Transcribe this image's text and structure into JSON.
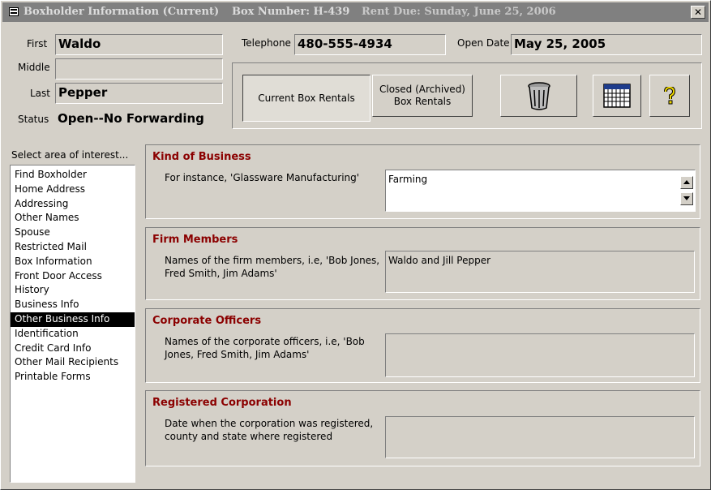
{
  "window": {
    "title": "Boxholder Information (Current)",
    "box_number": "Box Number: H-439",
    "rent_due": "Rent Due: Sunday, June 25, 2006",
    "close_glyph": "✕"
  },
  "fields": {
    "first_label": "First",
    "first_value": "Waldo",
    "middle_label": "Middle",
    "middle_value": "",
    "last_label": "Last",
    "last_value": "Pepper",
    "status_label": "Status",
    "status_value": "Open--No Forwarding",
    "telephone_label": "Telephone",
    "telephone_value": "480-555-4934",
    "open_date_label": "Open Date",
    "open_date_value": "May 25, 2005"
  },
  "toolbar": {
    "current_rentals_label": "Current Box Rentals",
    "closed_rentals_label": "Closed (Archived) Box Rentals",
    "trash_icon": "trash-can-icon",
    "calendar_icon": "calendar-icon",
    "help_icon": "question-mark-icon"
  },
  "nav": {
    "heading": "Select area of interest...",
    "items": [
      "Find Boxholder",
      "Home Address",
      "Addressing",
      "Other Names",
      "Spouse",
      "Restricted Mail",
      "Box Information",
      "Front Door Access",
      "History",
      "Business Info",
      "Other Business Info",
      "Identification",
      "Credit Card Info",
      "Other Mail Recipients",
      "Printable Forms"
    ],
    "selected_index": 10
  },
  "panels": {
    "kind_of_business": {
      "title": "Kind of Business",
      "description": "For instance, 'Glassware Manufacturing'",
      "value": "Farming"
    },
    "firm_members": {
      "title": "Firm Members",
      "description": "Names of the firm members, i.e, 'Bob Jones, Fred Smith, Jim Adams'",
      "value": "Waldo and Jill Pepper"
    },
    "corporate_officers": {
      "title": "Corporate Officers",
      "description": "Names of the corporate officers, i.e, 'Bob Jones, Fred Smith, Jim Adams'",
      "value": ""
    },
    "registered_corporation": {
      "title": "Registered Corporation",
      "description": "Date when the corporation was registered, county and state where registered",
      "value": ""
    }
  },
  "colors": {
    "panel_title": "#8b0000",
    "window_bg": "#d4d0c8",
    "titlebar_bg": "#808080"
  }
}
